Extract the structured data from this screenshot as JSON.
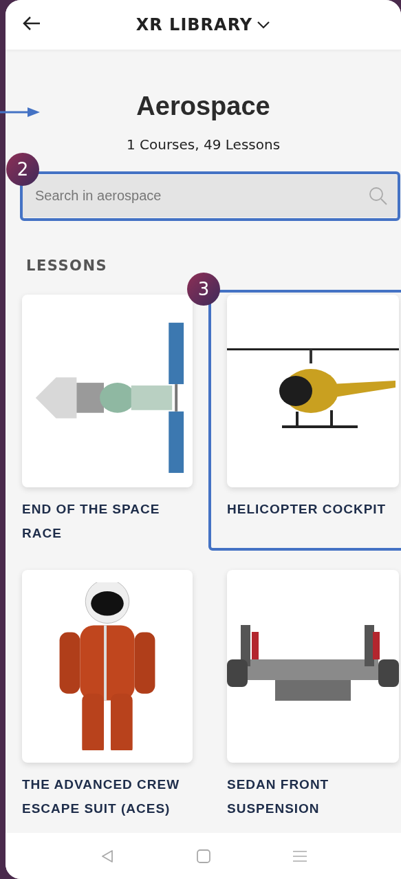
{
  "header": {
    "title": "XR LIBRARY"
  },
  "category": {
    "title": "Aerospace",
    "summary": "1 Courses, 49 Lessons"
  },
  "search": {
    "placeholder": "Search in aerospace",
    "callout": "2"
  },
  "section_title": "LESSONS",
  "lessons": [
    {
      "title": "END OF THE SPACE RACE"
    },
    {
      "title": "HELICOPTER COCKPIT",
      "callout": "3"
    },
    {
      "title": "THE ADVANCED CREW ESCAPE SUIT (ACES)"
    },
    {
      "title": "SEDAN FRONT SUSPENSION"
    }
  ]
}
